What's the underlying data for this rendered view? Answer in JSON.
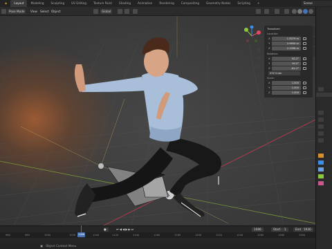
{
  "workspaces": [
    "Layout",
    "Modeling",
    "Sculpting",
    "UV Editing",
    "Texture Paint",
    "Shading",
    "Animation",
    "Rendering",
    "Compositing",
    "Geometry Nodes",
    "Scripting"
  ],
  "active_workspace": "Layout",
  "scene": "Scene",
  "header": {
    "mode": "Pose Mode",
    "view": "View",
    "select": "Select",
    "pose": "Pose",
    "object": "Object",
    "orientation": "Global",
    "options": "Options"
  },
  "npanel": {
    "title": "Transform",
    "location_label": "Location:",
    "rotation_label": "Rotation:",
    "rotation_mode": "XYZ Euler",
    "scale_label": "Scale:",
    "location": [
      {
        "ax": "X",
        "val": "1.5079 m"
      },
      {
        "ax": "Y",
        "val": "2.9850 m"
      },
      {
        "ax": "Z",
        "val": "2.2398 m"
      }
    ],
    "rotation": [
      {
        "ax": "X",
        "val": "82.2°"
      },
      {
        "ax": "Y",
        "val": "90.5°"
      },
      {
        "ax": "Z",
        "val": "-82.1°"
      }
    ],
    "scale": [
      {
        "ax": "X",
        "val": "1.000"
      },
      {
        "ax": "Y",
        "val": "1.000"
      },
      {
        "ax": "Z",
        "val": "1.000"
      }
    ],
    "tabs": [
      "Item",
      "Tool",
      "View"
    ]
  },
  "timeline": {
    "current_frame": "1086",
    "start_label": "Start",
    "start": "1",
    "end_label": "End",
    "end": "1930",
    "ticks": [
      "960",
      "980",
      "1000",
      "1020",
      "1040",
      "1060",
      "1080",
      "1100",
      "1120",
      "1140",
      "1160",
      "1180",
      "1200",
      "1220",
      "1240",
      "1260",
      "1280",
      "1300",
      "1320",
      "1340",
      "1360"
    ],
    "playhead": "1086"
  },
  "status": {
    "hint": "Object Context Menu",
    "version": ""
  },
  "colors": {
    "accent": "#4772b3",
    "x_axis": "#e5475f",
    "y_axis": "#8cc63f",
    "z_axis": "#3b8ee6"
  }
}
